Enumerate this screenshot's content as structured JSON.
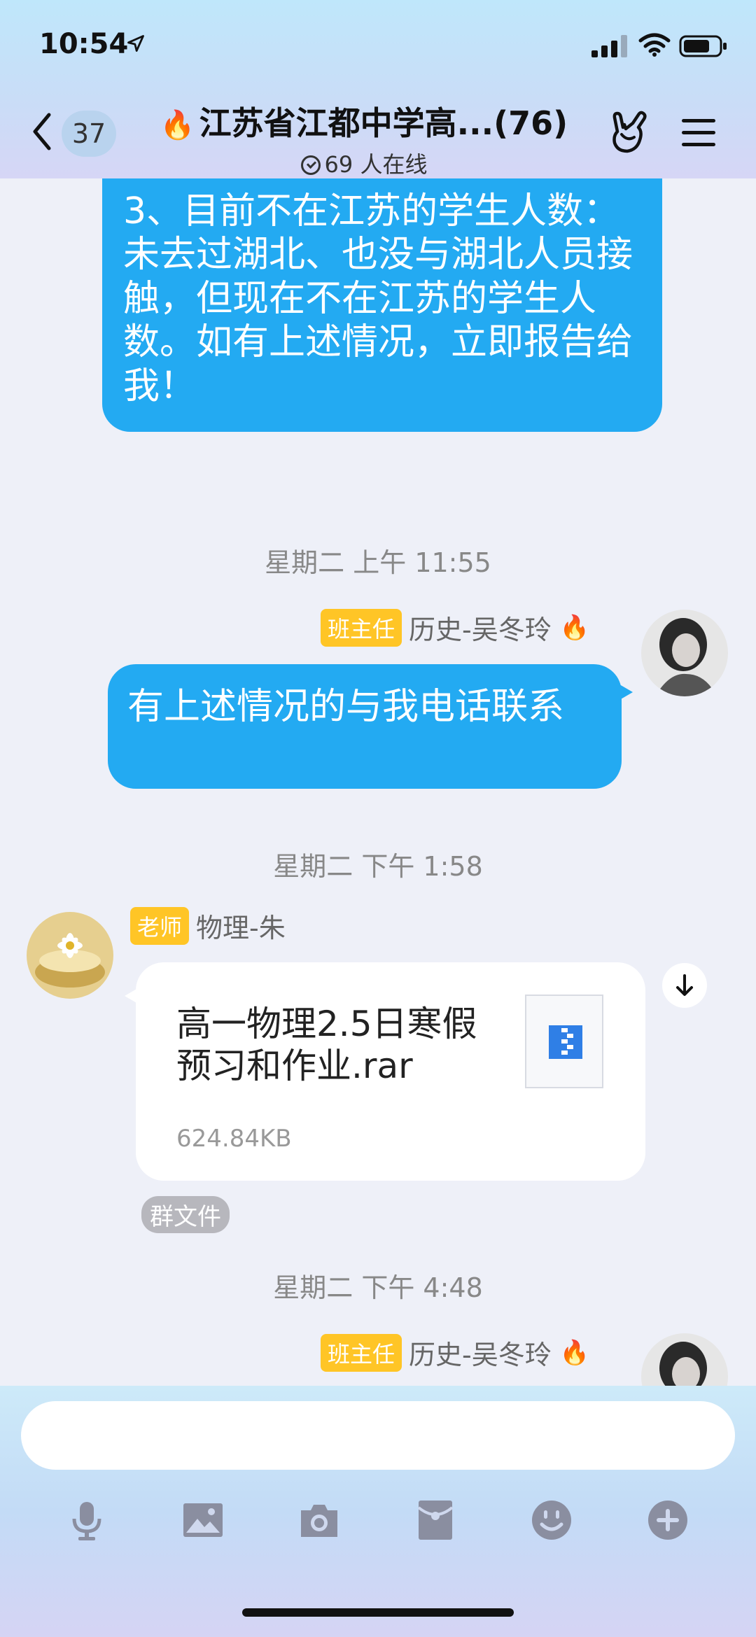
{
  "status_bar": {
    "time": "10:54"
  },
  "nav": {
    "unread_count": "37",
    "title": "江苏省江都中学高...(76)",
    "online": "69 人在线"
  },
  "messages": {
    "m1_text": "3、目前不在江苏的学生人数：未去过湖北、也没与湖北人员接触，但现在不在江苏的学生人数。如有上述情况，立即报告给我！",
    "ts1": "星期二 上午 11:55",
    "m2_tag": "班主任",
    "m2_sender": "历史-吴冬玲",
    "m2_text": "有上述情况的与我电话联系",
    "ts2": "星期二 下午 1:58",
    "m3_tag": "老师",
    "m3_sender": "物理-朱",
    "file_name": "高一物理2.5日寒假预习和作业.rar",
    "file_size": "624.84KB",
    "file_badge": "群文件",
    "ts3": "星期二 下午 4:48",
    "m4_tag": "班主任",
    "m4_sender": "历史-吴冬玲"
  },
  "toolbar": {
    "icons": [
      "microphone-icon",
      "image-icon",
      "camera-icon",
      "red-packet-icon",
      "emoji-icon",
      "plus-icon"
    ]
  },
  "colors": {
    "bubble": "#23aaf2",
    "tag": "#ffc526"
  }
}
